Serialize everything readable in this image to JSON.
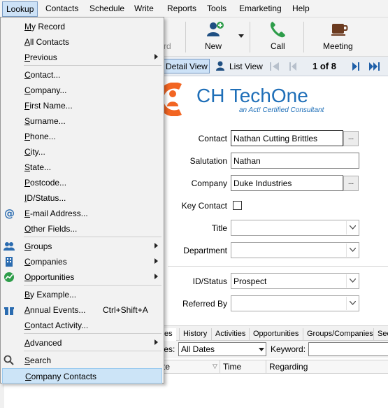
{
  "menubar": {
    "items": [
      "Lookup",
      "Contacts",
      "Schedule",
      "Write",
      "Reports",
      "Tools",
      "Emarketing",
      "Help"
    ]
  },
  "toolbar": {
    "cut_label": "rd",
    "new_label": "New",
    "call_label": "Call",
    "meeting_label": "Meeting"
  },
  "viewbar": {
    "detail_view": "Detail View",
    "list_view": "List View",
    "record_counter": "1 of 8"
  },
  "logo": {
    "title": "CH TechOne",
    "subtitle": "an Act! Certified Consultant"
  },
  "form": {
    "contact_label": "Contact",
    "contact_value": "Nathan Cutting Brittles",
    "salutation_label": "Salutation",
    "salutation_value": "Nathan",
    "company_label": "Company",
    "company_value": "Duke Industries",
    "key_contact_label": "Key Contact",
    "title_label": "Title",
    "title_value": "",
    "department_label": "Department",
    "department_value": "",
    "id_status_label": "ID/Status",
    "id_status_value": "Prospect",
    "referred_by_label": "Referred By",
    "referred_by_value": "",
    "ellipsis": "..."
  },
  "tabs": [
    "tes",
    "History",
    "Activities",
    "Opportunities",
    "Groups/Companies",
    "Sec"
  ],
  "filters": {
    "dates_label": "tes:",
    "dates_value": "All Dates",
    "keyword_label": "Keyword:"
  },
  "grid_columns": [
    "te",
    "Time",
    "Regarding"
  ],
  "lookup_menu": {
    "items": [
      {
        "label": "My Record",
        "ul": 0
      },
      {
        "label": "All Contacts",
        "ul": 0
      },
      {
        "label": "Previous",
        "ul": 0,
        "submenu": true
      },
      {
        "label": "Contact...",
        "ul": 0
      },
      {
        "label": "Company...",
        "ul": 0
      },
      {
        "label": "First Name...",
        "ul": 0
      },
      {
        "label": "Surname...",
        "ul": 0
      },
      {
        "label": "Phone...",
        "ul": 0
      },
      {
        "label": "City...",
        "ul": 0
      },
      {
        "label": "State...",
        "ul": 0
      },
      {
        "label": "Postcode...",
        "ul": 0
      },
      {
        "label": "ID/Status...",
        "ul": 0
      },
      {
        "label": "E-mail Address...",
        "ul": 0,
        "icon": "email-at-icon"
      },
      {
        "label": "Other Fields...",
        "ul": 0
      },
      {
        "label": "Groups",
        "ul": 0,
        "submenu": true,
        "icon": "groups-icon"
      },
      {
        "label": "Companies",
        "ul": 0,
        "submenu": true,
        "icon": "companies-icon"
      },
      {
        "label": "Opportunities",
        "ul": 0,
        "submenu": true,
        "icon": "opportunities-icon"
      },
      {
        "label": "By Example...",
        "ul": 0
      },
      {
        "label": "Annual Events...",
        "ul": 0,
        "shortcut": "Ctrl+Shift+A",
        "icon": "gift-icon"
      },
      {
        "label": "Contact Activity...",
        "ul": 0
      },
      {
        "label": "Advanced",
        "ul": 0,
        "submenu": true
      },
      {
        "label": "Search",
        "ul": 0,
        "icon": "search-icon"
      },
      {
        "label": "Company Contacts",
        "ul": 0,
        "highlighted": true
      }
    ]
  },
  "colors": {
    "accent_orange": "#f26522",
    "brand_blue": "#1f6fb8",
    "menu_highlight": "#cce4f7",
    "call_green": "#2e9d4a"
  }
}
